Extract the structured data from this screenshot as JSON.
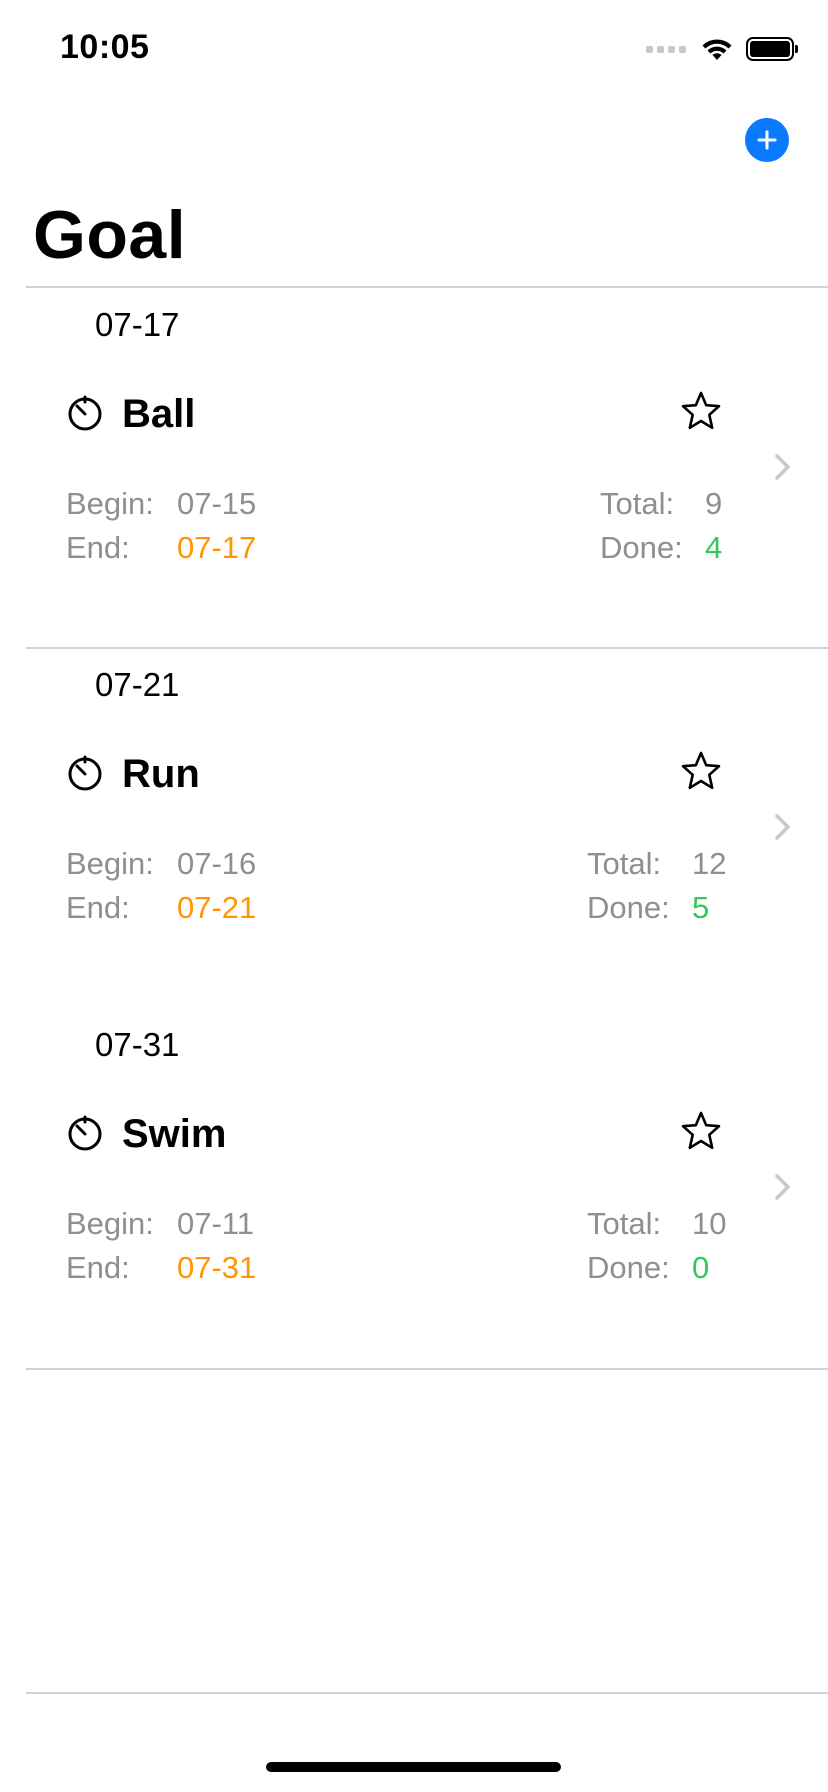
{
  "status_bar": {
    "time": "10:05"
  },
  "nav": {
    "title": "Goal",
    "add_icon": "plus-circle-icon",
    "accent": "#0a7aff"
  },
  "colors": {
    "end_date": "#ff9500",
    "done_count": "#34c759",
    "label": "#8e8e93"
  },
  "labels": {
    "begin": "Begin:",
    "end": "End:",
    "total": "Total:",
    "done": "Done:"
  },
  "goals": [
    {
      "section_date": "07-17",
      "name": "Ball",
      "begin": "07-15",
      "end": "07-17",
      "total": "9",
      "done": "4"
    },
    {
      "section_date": "07-21",
      "name": "Run",
      "begin": "07-16",
      "end": "07-21",
      "total": "12",
      "done": "5"
    },
    {
      "section_date": "07-31",
      "name": "Swim",
      "begin": "07-11",
      "end": "07-31",
      "total": "10",
      "done": "0"
    }
  ]
}
